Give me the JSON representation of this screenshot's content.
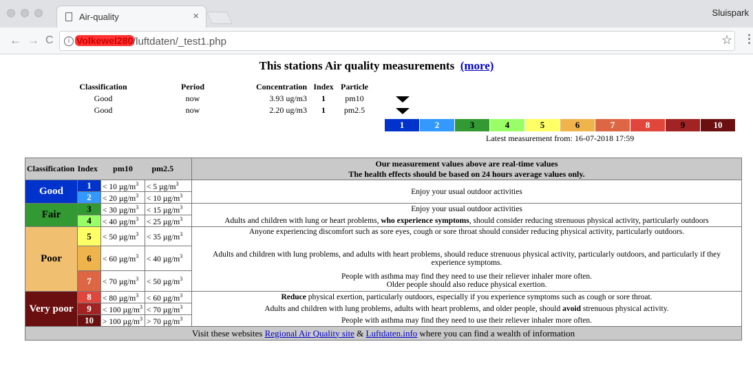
{
  "browser": {
    "tab_title": "Air-quality",
    "tab_close": "×",
    "profile": "Sluispark",
    "url_host": "Volkewel280",
    "url_path": "/luftdaten/_test1.php"
  },
  "page": {
    "title": "This stations Air quality measurements",
    "more_link": "(more)",
    "measure_headers": [
      "Classification",
      "Period",
      "Concentration",
      "Index",
      "Particle"
    ],
    "measurements": [
      {
        "classification": "Good",
        "period": "now",
        "concentration": "3.93 ug/m3",
        "index": "1",
        "particle": "pm10"
      },
      {
        "classification": "Good",
        "period": "now",
        "concentration": "2.20 ug/m3",
        "index": "1",
        "particle": "pm2.5"
      }
    ],
    "scale": [
      {
        "label": "1",
        "color": "#0033cc",
        "text": "#ffffff"
      },
      {
        "label": "2",
        "color": "#3399ff",
        "text": "#ffffff"
      },
      {
        "label": "3",
        "color": "#339933",
        "text": "#000000"
      },
      {
        "label": "4",
        "color": "#99ff66",
        "text": "#000000"
      },
      {
        "label": "5",
        "color": "#ffff66",
        "text": "#000000"
      },
      {
        "label": "6",
        "color": "#f0b44c",
        "text": "#000000"
      },
      {
        "label": "7",
        "color": "#dd6644",
        "text": "#ffffff"
      },
      {
        "label": "8",
        "color": "#e0463c",
        "text": "#ffffff"
      },
      {
        "label": "9",
        "color": "#a12323",
        "text": "#000000"
      },
      {
        "label": "10",
        "color": "#6b1010",
        "text": "#ffffff"
      }
    ],
    "latest": "Latest measurement from: 16-07-2018 17:59",
    "ref_headers": {
      "classification": "Classification",
      "index": "Index",
      "pm10": "pm10",
      "pm25": "pm2.5",
      "note_line1": "Our measurement values above are real-time values",
      "note_line2": "The health effects should be based on 24 hours average values only."
    },
    "classes": {
      "good": {
        "label": "Good",
        "color": "#0033cc"
      },
      "fair": {
        "label": "Fair",
        "color": "#339933"
      },
      "poor": {
        "label": "Poor",
        "color": "#f0c070"
      },
      "very_poor": {
        "label": "Very poor",
        "color": "#6b1010"
      }
    },
    "rows": [
      {
        "index": "1",
        "pm10": "< 10 µg/m",
        "pm25": "< 5 µg/m"
      },
      {
        "index": "2",
        "pm10": "< 20 µg/m",
        "pm25": "< 10 µg/m"
      },
      {
        "index": "3",
        "pm10": "< 30 µg/m",
        "pm25": "< 15 µg/m"
      },
      {
        "index": "4",
        "pm10": "< 40 µg/m",
        "pm25": "< 25 µg/m"
      },
      {
        "index": "5",
        "pm10": "< 50 µg/m",
        "pm25": "< 35 µg/m"
      },
      {
        "index": "6",
        "pm10": "< 60 µg/m",
        "pm25": "< 40 µg/m"
      },
      {
        "index": "7",
        "pm10": "< 70 µg/m",
        "pm25": "< 50 µg/m"
      },
      {
        "index": "8",
        "pm10": "< 80 µg/m",
        "pm25": "< 60 µg/m"
      },
      {
        "index": "9",
        "pm10": "< 100 µg/m",
        "pm25": "< 70 µg/m"
      },
      {
        "index": "10",
        "pm10": "> 100 µg/m",
        "pm25": "> 70 µg/m"
      }
    ],
    "unit_exp": "3",
    "effects": {
      "good": "Enjoy your usual outdoor activities",
      "fair_1": "Enjoy your usual outdoor activities",
      "fair_2a": "Adults and children with lung or heart problems,",
      "fair_2b": "who experience symptoms",
      "fair_2c": ", should consider reducing strenuous physical activity, particularly outdoors",
      "poor_5": "Anyone experiencing discomfort such as sore eyes, cough or sore throat should consider reducing physical activity, particularly outdoors.",
      "poor_6": "Adults and children with lung problems, and adults with heart problems, should reduce strenuous physical activity, particularly outdoors, and particularly if they experience symptoms.",
      "poor_7a": "People with asthma may find they need to use their reliever inhaler more often.",
      "poor_7b": "Older people should also reduce physical exertion.",
      "vp_8a": "Reduce",
      "vp_8b": " physical exertion, particularly outdoors, especially if you experience symptoms such as cough or sore throat.",
      "vp_9a": "Adults and children with lung problems, adults with heart problems, and older people, should ",
      "vp_9b": "avoid",
      "vp_9c": " strenuous physical activity.",
      "vp_10": "People with asthma may find they need to use their reliever inhaler more often."
    },
    "footer": {
      "pre": "Visit these websites ",
      "link1": "Regional Air Quality site",
      "amp": " & ",
      "link2": "Luftdaten.info",
      "post": " where you can find a wealth of information"
    }
  }
}
